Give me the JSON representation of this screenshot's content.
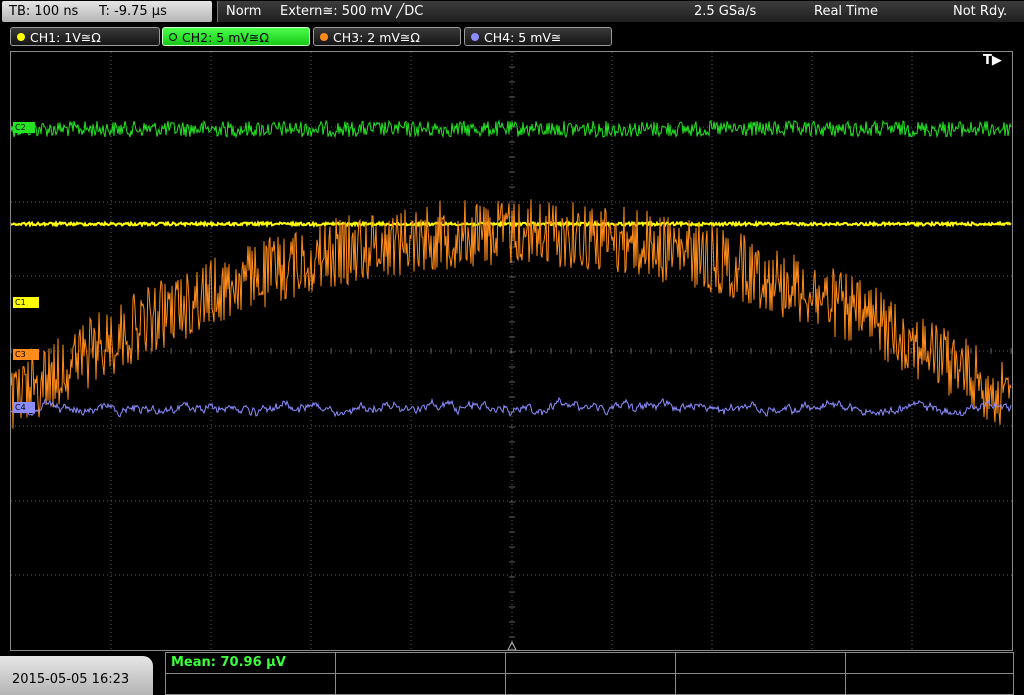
{
  "top_bar": {
    "timebase": "TB: 100 ns",
    "trigger_time": "T: -9.75 µs",
    "mode": "Norm",
    "trigger_source": "Extern≅: 500 mV ╱DC",
    "sample_rate": "2.5 GSa/s",
    "acquisition": "Real Time",
    "status": "Not Rdy."
  },
  "channels": [
    {
      "label": "CH1: 1V≅Ω",
      "color": "#ffff00",
      "active": false
    },
    {
      "label": "CH2: 5 mV≅Ω",
      "color": "#23e323",
      "active": true
    },
    {
      "label": "CH3: 2 mV≅Ω",
      "color": "#ff8c1a",
      "active": false
    },
    {
      "label": "CH4: 5 mV≅",
      "color": "#8c8cff",
      "active": false
    }
  ],
  "markers": {
    "c1": "C1",
    "c2": "C2",
    "c3": "C3",
    "c4": "C4"
  },
  "trigger_marker": "T▶",
  "measurement": {
    "mean": "Mean: 70.96 µV"
  },
  "datetime": "2015-05-05 16:23",
  "colors": {
    "ch1": "#ffff00",
    "ch2": "#23e323",
    "ch3": "#ff8c1a",
    "ch4": "#8c8cff",
    "grid": "#5a5a5a"
  }
}
